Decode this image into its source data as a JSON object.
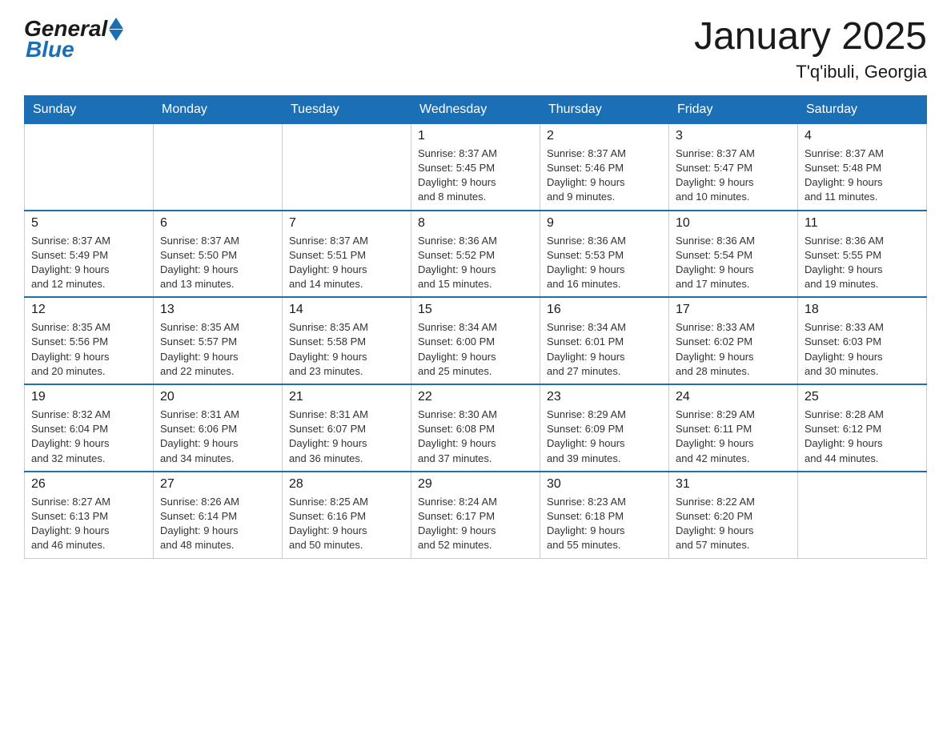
{
  "header": {
    "logo_general": "General",
    "logo_blue": "Blue",
    "month_title": "January 2025",
    "location": "T'q'ibuli, Georgia"
  },
  "days_of_week": [
    "Sunday",
    "Monday",
    "Tuesday",
    "Wednesday",
    "Thursday",
    "Friday",
    "Saturday"
  ],
  "weeks": [
    [
      {
        "day": "",
        "info": ""
      },
      {
        "day": "",
        "info": ""
      },
      {
        "day": "",
        "info": ""
      },
      {
        "day": "1",
        "info": "Sunrise: 8:37 AM\nSunset: 5:45 PM\nDaylight: 9 hours\nand 8 minutes."
      },
      {
        "day": "2",
        "info": "Sunrise: 8:37 AM\nSunset: 5:46 PM\nDaylight: 9 hours\nand 9 minutes."
      },
      {
        "day": "3",
        "info": "Sunrise: 8:37 AM\nSunset: 5:47 PM\nDaylight: 9 hours\nand 10 minutes."
      },
      {
        "day": "4",
        "info": "Sunrise: 8:37 AM\nSunset: 5:48 PM\nDaylight: 9 hours\nand 11 minutes."
      }
    ],
    [
      {
        "day": "5",
        "info": "Sunrise: 8:37 AM\nSunset: 5:49 PM\nDaylight: 9 hours\nand 12 minutes."
      },
      {
        "day": "6",
        "info": "Sunrise: 8:37 AM\nSunset: 5:50 PM\nDaylight: 9 hours\nand 13 minutes."
      },
      {
        "day": "7",
        "info": "Sunrise: 8:37 AM\nSunset: 5:51 PM\nDaylight: 9 hours\nand 14 minutes."
      },
      {
        "day": "8",
        "info": "Sunrise: 8:36 AM\nSunset: 5:52 PM\nDaylight: 9 hours\nand 15 minutes."
      },
      {
        "day": "9",
        "info": "Sunrise: 8:36 AM\nSunset: 5:53 PM\nDaylight: 9 hours\nand 16 minutes."
      },
      {
        "day": "10",
        "info": "Sunrise: 8:36 AM\nSunset: 5:54 PM\nDaylight: 9 hours\nand 17 minutes."
      },
      {
        "day": "11",
        "info": "Sunrise: 8:36 AM\nSunset: 5:55 PM\nDaylight: 9 hours\nand 19 minutes."
      }
    ],
    [
      {
        "day": "12",
        "info": "Sunrise: 8:35 AM\nSunset: 5:56 PM\nDaylight: 9 hours\nand 20 minutes."
      },
      {
        "day": "13",
        "info": "Sunrise: 8:35 AM\nSunset: 5:57 PM\nDaylight: 9 hours\nand 22 minutes."
      },
      {
        "day": "14",
        "info": "Sunrise: 8:35 AM\nSunset: 5:58 PM\nDaylight: 9 hours\nand 23 minutes."
      },
      {
        "day": "15",
        "info": "Sunrise: 8:34 AM\nSunset: 6:00 PM\nDaylight: 9 hours\nand 25 minutes."
      },
      {
        "day": "16",
        "info": "Sunrise: 8:34 AM\nSunset: 6:01 PM\nDaylight: 9 hours\nand 27 minutes."
      },
      {
        "day": "17",
        "info": "Sunrise: 8:33 AM\nSunset: 6:02 PM\nDaylight: 9 hours\nand 28 minutes."
      },
      {
        "day": "18",
        "info": "Sunrise: 8:33 AM\nSunset: 6:03 PM\nDaylight: 9 hours\nand 30 minutes."
      }
    ],
    [
      {
        "day": "19",
        "info": "Sunrise: 8:32 AM\nSunset: 6:04 PM\nDaylight: 9 hours\nand 32 minutes."
      },
      {
        "day": "20",
        "info": "Sunrise: 8:31 AM\nSunset: 6:06 PM\nDaylight: 9 hours\nand 34 minutes."
      },
      {
        "day": "21",
        "info": "Sunrise: 8:31 AM\nSunset: 6:07 PM\nDaylight: 9 hours\nand 36 minutes."
      },
      {
        "day": "22",
        "info": "Sunrise: 8:30 AM\nSunset: 6:08 PM\nDaylight: 9 hours\nand 37 minutes."
      },
      {
        "day": "23",
        "info": "Sunrise: 8:29 AM\nSunset: 6:09 PM\nDaylight: 9 hours\nand 39 minutes."
      },
      {
        "day": "24",
        "info": "Sunrise: 8:29 AM\nSunset: 6:11 PM\nDaylight: 9 hours\nand 42 minutes."
      },
      {
        "day": "25",
        "info": "Sunrise: 8:28 AM\nSunset: 6:12 PM\nDaylight: 9 hours\nand 44 minutes."
      }
    ],
    [
      {
        "day": "26",
        "info": "Sunrise: 8:27 AM\nSunset: 6:13 PM\nDaylight: 9 hours\nand 46 minutes."
      },
      {
        "day": "27",
        "info": "Sunrise: 8:26 AM\nSunset: 6:14 PM\nDaylight: 9 hours\nand 48 minutes."
      },
      {
        "day": "28",
        "info": "Sunrise: 8:25 AM\nSunset: 6:16 PM\nDaylight: 9 hours\nand 50 minutes."
      },
      {
        "day": "29",
        "info": "Sunrise: 8:24 AM\nSunset: 6:17 PM\nDaylight: 9 hours\nand 52 minutes."
      },
      {
        "day": "30",
        "info": "Sunrise: 8:23 AM\nSunset: 6:18 PM\nDaylight: 9 hours\nand 55 minutes."
      },
      {
        "day": "31",
        "info": "Sunrise: 8:22 AM\nSunset: 6:20 PM\nDaylight: 9 hours\nand 57 minutes."
      },
      {
        "day": "",
        "info": ""
      }
    ]
  ]
}
